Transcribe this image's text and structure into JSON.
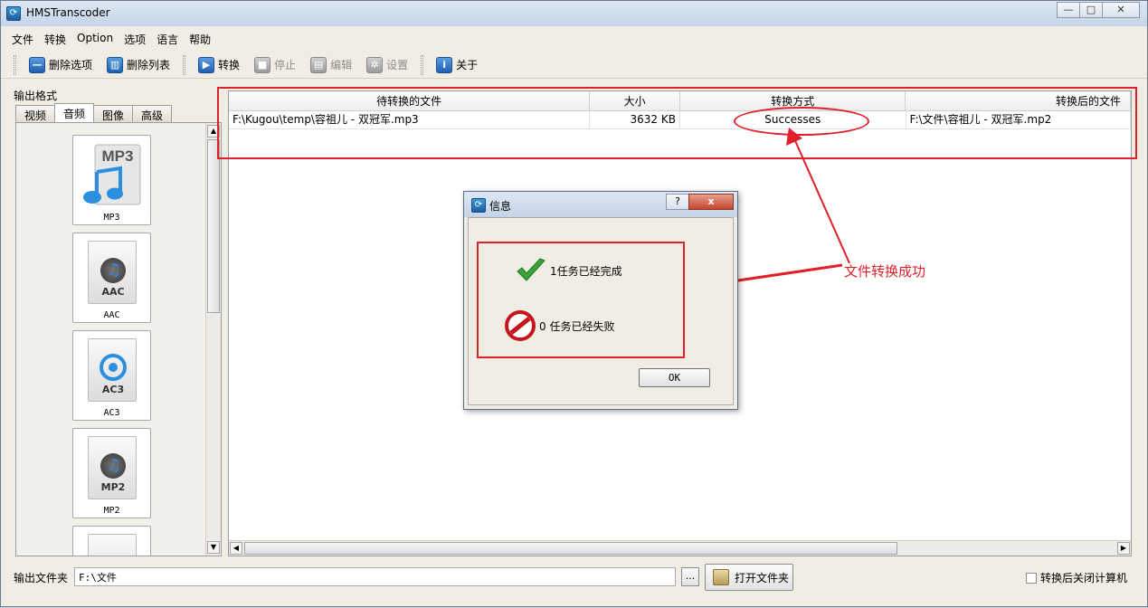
{
  "window": {
    "title": "HMSTranscoder"
  },
  "menu": [
    "文件",
    "转换",
    "Option",
    "选项",
    "语言",
    "帮助"
  ],
  "toolbar": {
    "delete_option": "删除选项",
    "delete_list": "删除列表",
    "convert": "转换",
    "stop": "停止",
    "edit": "编辑",
    "settings": "设置",
    "about": "关于"
  },
  "left_panel": {
    "label": "输出格式",
    "tabs": [
      "视频",
      "音频",
      "图像",
      "高级"
    ],
    "active_tab": "音频",
    "formats": [
      {
        "name": "MP3",
        "tag": "MP3"
      },
      {
        "name": "AAC",
        "tag": "AAC"
      },
      {
        "name": "AC3",
        "tag": "AC3"
      },
      {
        "name": "MP2",
        "tag": "MP2"
      }
    ]
  },
  "table": {
    "headers": [
      "待转换的文件",
      "大小",
      "转换方式",
      "转换后的文件"
    ],
    "rows": [
      {
        "source": "F:\\Kugou\\temp\\容祖儿 - 双冠军.mp3",
        "size": "3632 KB",
        "method": "Successes",
        "target": "F:\\文件\\容祖儿 - 双冠军.mp2"
      }
    ]
  },
  "dialog": {
    "title": "信息",
    "help_label": "?",
    "close_label": "x",
    "success_msg": "1任务已经完成",
    "fail_msg": "0 任务已经失败",
    "ok_label": "OK"
  },
  "annotation": {
    "text": "文件转换成功"
  },
  "bottom": {
    "output_label": "输出文件夹",
    "output_path": "F:\\文件",
    "browse_label": "...",
    "open_folder_label": "打开文件夹",
    "shutdown_label": "转换后关闭计算机"
  },
  "colors": {
    "annotation_red": "#e0202a"
  }
}
